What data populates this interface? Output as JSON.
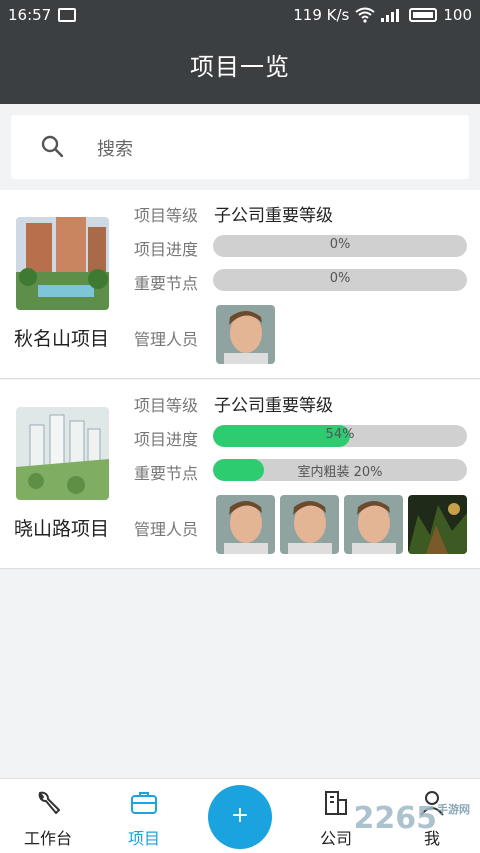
{
  "status": {
    "time": "16:57",
    "speed": "119 K/s",
    "battery": "100"
  },
  "header": {
    "title": "项目一览"
  },
  "search": {
    "placeholder": "搜索"
  },
  "projects": [
    {
      "name": "秋名山项目",
      "level_label": "项目等级",
      "level": "子公司重要等级",
      "progress_label": "项目进度",
      "progress_text": "0%",
      "progress": 0,
      "milestone_label": "重要节点",
      "milestone_text": "0%",
      "milestone": 0,
      "managers_label": "管理人员"
    },
    {
      "name": "晓山路项目",
      "level_label": "项目等级",
      "level": "子公司重要等级",
      "progress_label": "项目进度",
      "progress_text": "54%",
      "progress": 54,
      "milestone_label": "重要节点",
      "milestone_text": "室内粗装 20%",
      "milestone": 20,
      "managers_label": "管理人员"
    }
  ],
  "tabs": {
    "workbench": "工作台",
    "projects": "项目",
    "add": "+",
    "company": "公司",
    "me": "我"
  },
  "colors": {
    "header": "#3b3f42",
    "accent": "#1aa3df",
    "progress": "#2ecc71"
  },
  "watermark": {
    "main": "2265",
    "sub": "手游网"
  }
}
